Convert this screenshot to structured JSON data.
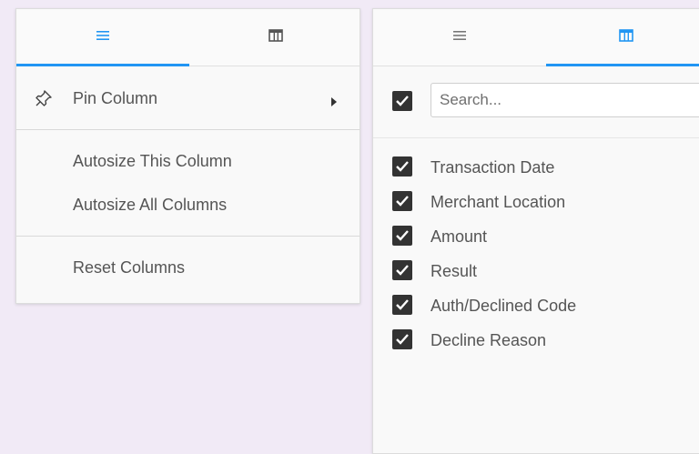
{
  "column_menu": {
    "tabs": [
      {
        "icon": "hamburger-icon",
        "active": true
      },
      {
        "icon": "columns-icon",
        "active": false
      }
    ],
    "items": [
      {
        "label": "Pin Column",
        "icon": "pin-icon",
        "submenu": true
      },
      {
        "label": "Autosize This Column"
      },
      {
        "label": "Autosize All Columns"
      },
      {
        "label": "Reset Columns"
      }
    ]
  },
  "columns_panel": {
    "tabs": [
      {
        "icon": "hamburger-icon",
        "active": false
      },
      {
        "icon": "columns-icon",
        "active": true
      }
    ],
    "select_all_checked": true,
    "search_placeholder": "Search...",
    "columns": [
      {
        "label": "Transaction Date",
        "checked": true
      },
      {
        "label": "Merchant Location",
        "checked": true
      },
      {
        "label": "Amount",
        "checked": true
      },
      {
        "label": "Result",
        "checked": true
      },
      {
        "label": "Auth/Declined Code",
        "checked": true
      },
      {
        "label": "Decline Reason",
        "checked": true
      }
    ]
  },
  "colors": {
    "accent": "#2196f3",
    "checkbox": "#333333",
    "background": "#f1eaf6"
  }
}
